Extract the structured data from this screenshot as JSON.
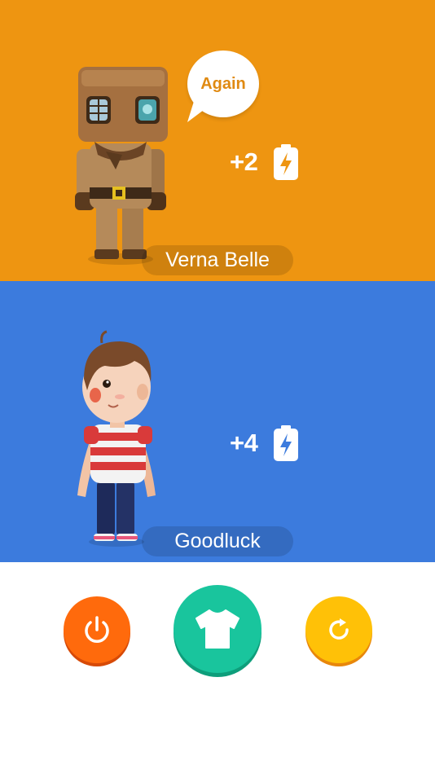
{
  "players": [
    {
      "name": "Verna Belle",
      "reward": "+2",
      "speech": "Again",
      "avatar_icon": "diver-character-icon",
      "panel_color": "#EE9511"
    },
    {
      "name": "Goodluck",
      "reward": "+4",
      "avatar_icon": "boy-character-icon",
      "panel_color": "#3C7BDD"
    }
  ],
  "controls": {
    "power_icon": "power-icon",
    "outfit_icon": "shirt-icon",
    "refresh_icon": "refresh-icon",
    "power_color": "#FF6A0C",
    "outfit_color": "#19C59D",
    "refresh_color": "#FFC107"
  }
}
